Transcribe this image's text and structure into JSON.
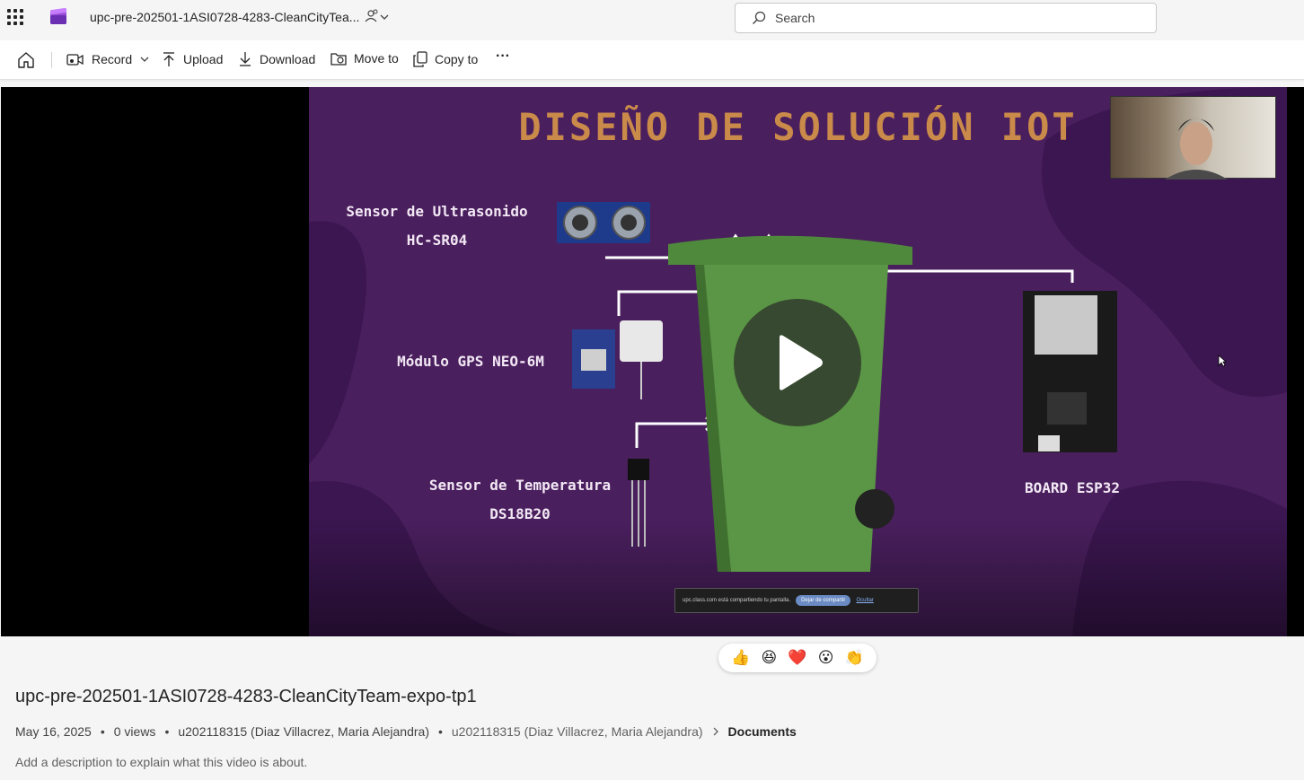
{
  "header": {
    "document_title": "upc-pre-202501-1ASI0728-4283-CleanCityTea...",
    "search_placeholder": "Search"
  },
  "toolbar": {
    "record_label": "Record",
    "upload_label": "Upload",
    "download_label": "Download",
    "move_label": "Move to",
    "copy_label": "Copy to",
    "more_label": "···"
  },
  "slide": {
    "title": "DISEÑO DE SOLUCIÓN IOT",
    "ultrasonic_label_1": "Sensor de Ultrasonido",
    "ultrasonic_label_2": "HC-SR04",
    "gps_label": "Módulo GPS NEO-6M",
    "temp_label_1": "Sensor de Temperatura",
    "temp_label_2": "DS18B20",
    "board_label": "BOARD ESP32",
    "share_notice": "upc.class.com está compartiendo tu pantalla.",
    "share_stop": "Dejar de compartir",
    "share_hide": "Ocultar"
  },
  "reactions": [
    "👍",
    "😆",
    "❤️",
    "😮",
    "👏"
  ],
  "video": {
    "title": "upc-pre-202501-1ASI0728-4283-CleanCityTeam-expo-tp1",
    "date": "May 16, 2025",
    "views": "0 views",
    "owner": "u202118315 (Diaz Villacrez, Maria Alejandra)",
    "location_owner": "u202118315 (Diaz Villacrez, Maria Alejandra)",
    "location_folder": "Documents",
    "description_placeholder": "Add a description to explain what this video is about."
  },
  "colors": {
    "slide_background": "#4a1f5e",
    "slide_title": "#c98a4a",
    "bin_green": "#4f8a3c"
  }
}
